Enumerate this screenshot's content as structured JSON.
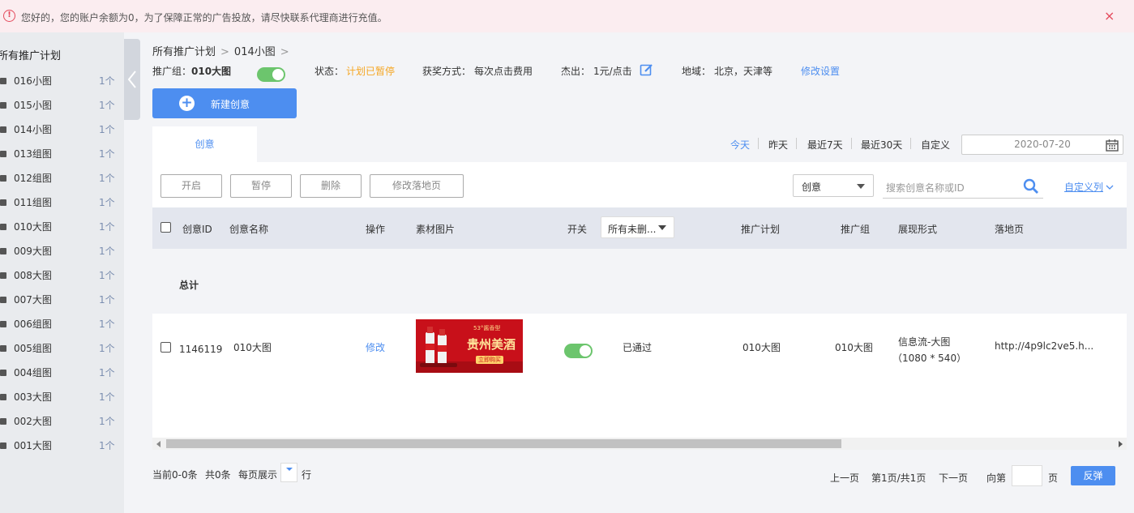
{
  "alert": {
    "message": "您好的，您的账户余额为0，为了保障正常的广告投放，请尽快联系代理商进行充值。",
    "close": "×"
  },
  "sidebar": {
    "title": "所有推广计划",
    "items": [
      {
        "label": "016小图",
        "count": "1个"
      },
      {
        "label": "015小图",
        "count": "1个"
      },
      {
        "label": "014小图",
        "count": "1个"
      },
      {
        "label": "013组图",
        "count": "1个"
      },
      {
        "label": "012组图",
        "count": "1个"
      },
      {
        "label": "011组图",
        "count": "1个"
      },
      {
        "label": "010大图",
        "count": "1个"
      },
      {
        "label": "009大图",
        "count": "1个"
      },
      {
        "label": "008大图",
        "count": "1个"
      },
      {
        "label": "007大图",
        "count": "1个"
      },
      {
        "label": "006组图",
        "count": "1个"
      },
      {
        "label": "005组图",
        "count": "1个"
      },
      {
        "label": "004组图",
        "count": "1个"
      },
      {
        "label": "003大图",
        "count": "1个"
      },
      {
        "label": "002大图",
        "count": "1个"
      },
      {
        "label": "001大图",
        "count": "1个"
      }
    ]
  },
  "breadcrumb": {
    "root": "所有推广计划",
    "current": "014小图",
    "sep": ">"
  },
  "info": {
    "group_label": "推广组：",
    "group_value": "010大图",
    "status_label": "状态：",
    "status_value": "计划已暂停",
    "status_color": "#f5a623",
    "reward_label": "获奖方式：",
    "reward_value": "每次点击费用",
    "bid_label": "杰出：",
    "bid_value": "1元/点击",
    "region_label": "地域：",
    "region_value": "北京，天津等",
    "modify_link": "修改设置"
  },
  "new_button": {
    "label": "新建创意"
  },
  "tab": {
    "label": "创意"
  },
  "date_filter": {
    "options": [
      "今天",
      "昨天",
      "最近7天",
      "最近30天",
      "自定义"
    ],
    "date_value": "2020-07-20"
  },
  "actions": {
    "enable": "开启",
    "pause": "暂停",
    "delete": "删除",
    "modify_landing": "修改落地页"
  },
  "search": {
    "select_value": "创意",
    "placeholder": "搜索创意名称或ID",
    "custom_columns": "自定义列"
  },
  "table": {
    "headers": {
      "id": "创意ID",
      "name": "创意名称",
      "op": "操作",
      "material": "素材图片",
      "switch": "开关",
      "filter": "所有未删...",
      "plan": "推广计划",
      "group": "推广组",
      "format": "展现形式",
      "landing": "落地页"
    },
    "total_label": "总计",
    "rows": [
      {
        "id": "1146119",
        "name": "010大图",
        "op": "修改",
        "status": "已通过",
        "plan": "010大图",
        "group": "010大图",
        "format_line1": "信息流-大图",
        "format_line2": "（1080 * 540）",
        "landing": "http://4p9lc2ve5.h..."
      }
    ]
  },
  "material": {
    "tag": "53°酱香型",
    "title": "贵州美酒",
    "button": "立即购买"
  },
  "footer": {
    "current": "当前0-0条",
    "total": "共0条",
    "per_page": "每页展示",
    "row_unit": "行",
    "prev": "上一页",
    "page_info": "第1页/共1页",
    "next": "下一页",
    "goto": "向第",
    "page_unit": "页",
    "confirm": "反弹"
  }
}
